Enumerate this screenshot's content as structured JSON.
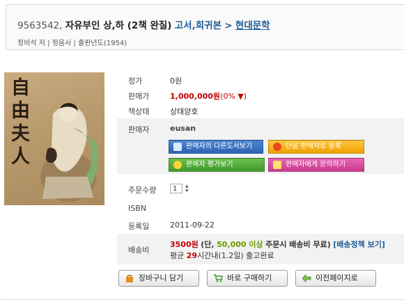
{
  "book": {
    "id": "9563542,",
    "name": "자유부인 상,하 (2책 완질)",
    "category": "고서,희귀본",
    "separator": ">",
    "subcategory": "현대문학",
    "meta": "정비석 저 | 정음사 | 출판년도(1954)",
    "cover_title_chars": [
      "自",
      "由",
      "夫",
      "人"
    ]
  },
  "info": {
    "list_price_label": "정가",
    "list_price": "0원",
    "sale_price_label": "판매가",
    "sale_price": "1,000,000원",
    "discount": "(0% ▼)",
    "condition_label": "책상태",
    "condition": "상태양호",
    "seller_label": "판매자",
    "seller": "eusan",
    "seller_buttons": {
      "other_books": "판매자의 다른도서보기",
      "register_fav": "단골 판매자로 등록",
      "rating": "판매자 평가보기",
      "inquiry": "판매자에게 문의하기"
    },
    "qty_label": "주문수량",
    "qty_value": "1",
    "isbn_label": "ISBN",
    "isbn": "",
    "reg_label": "등록일",
    "reg_date": "2011-09-22",
    "ship_label": "배송비",
    "ship_fee": "3500원",
    "ship_paren_a": "(단,",
    "ship_threshold": "50,000 이상",
    "ship_paren_b": "주문시 배송비 무료)",
    "ship_policy_link": "[배송정책 보기]",
    "ship_avg_prefix": "평균",
    "ship_hours": "29",
    "ship_avg_suffix": "시간내(1.2일) 출고완료"
  },
  "actions": {
    "cart": "장바구니 담기",
    "buy": "바로 구매하기",
    "back": "이전페이지로"
  },
  "colors": {
    "link_blue": "#1f5c99",
    "price_red": "#c00000",
    "free_green": "#6a9a00"
  }
}
